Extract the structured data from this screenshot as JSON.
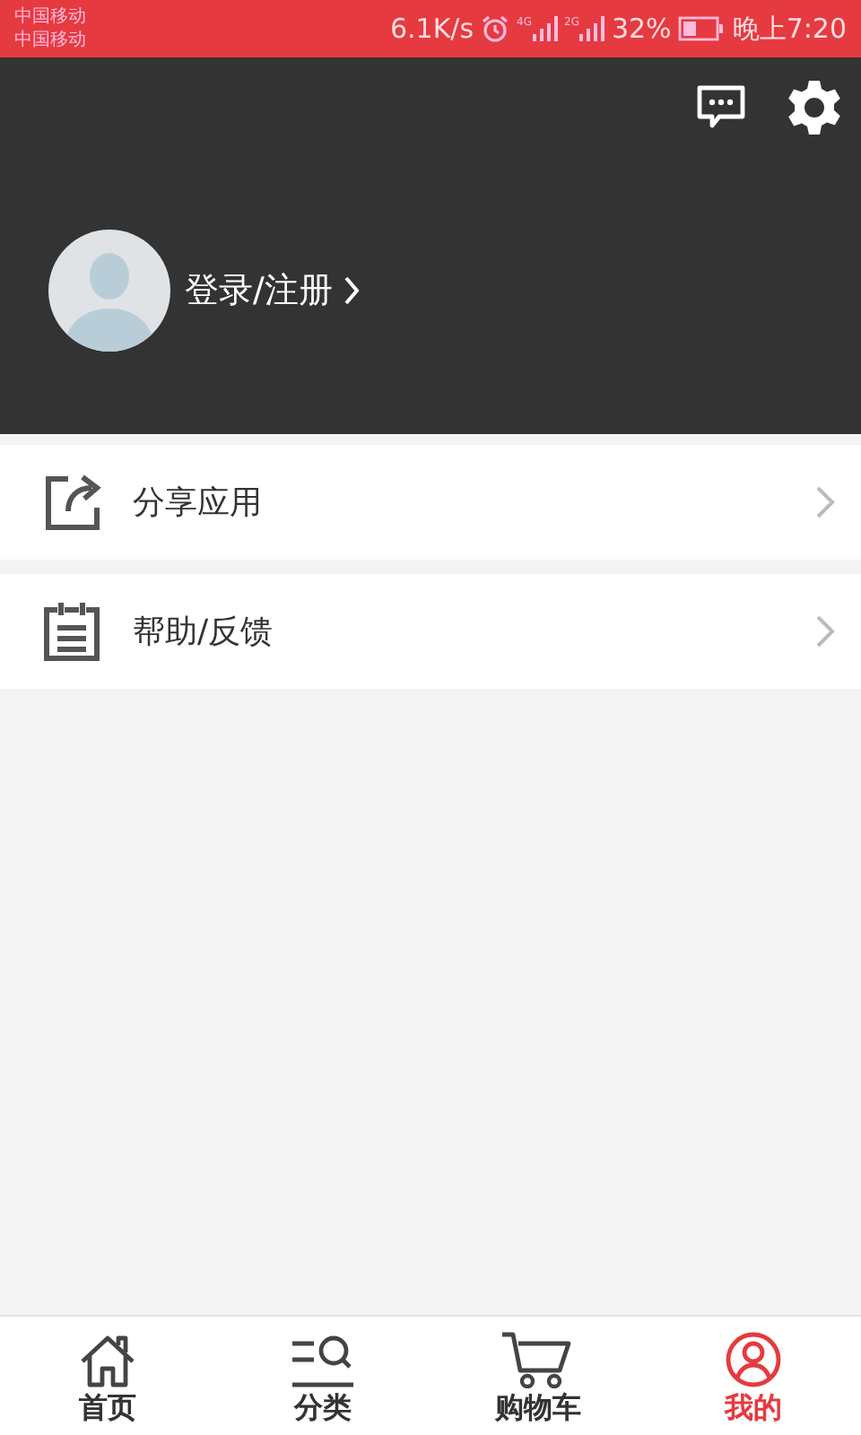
{
  "status_bar": {
    "carriers": [
      "中国移动",
      "中国移动"
    ],
    "speed": "6.1K/s",
    "networks": [
      "4G",
      "2G"
    ],
    "battery": "32%",
    "time": "晚上7:20"
  },
  "header": {
    "login_label": "登录/注册"
  },
  "menu_items": [
    {
      "kind": "share",
      "label": "分享应用"
    },
    {
      "kind": "help",
      "label": "帮助/反馈"
    }
  ],
  "tabs": [
    {
      "kind": "home",
      "label": "首页",
      "selected": false
    },
    {
      "kind": "category",
      "label": "分类",
      "selected": false
    },
    {
      "kind": "cart",
      "label": "购物车",
      "selected": false
    },
    {
      "kind": "profile",
      "label": "我的",
      "selected": true
    }
  ]
}
